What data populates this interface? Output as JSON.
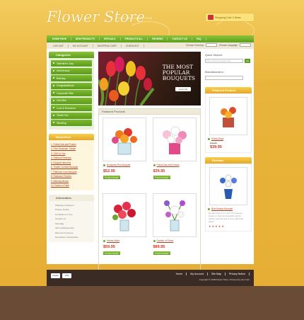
{
  "header": {
    "logo": "Flower Store",
    "tagline": "YOUR FAVORITE STORE",
    "cart_label": "Shopping Cart: 0 items"
  },
  "nav": [
    "HOME PAGE",
    "NEW PRODUCTS",
    "SPECIALS",
    "PRODUCTS ALL",
    "REVIEWS",
    "CONTACT US",
    "FAQ"
  ],
  "subnav": [
    "LOG OUT",
    "MY ACCOUNT",
    "SHOPPING CART",
    "CHECKOUT"
  ],
  "currency": {
    "label": "Choose Currency",
    "language": "Choose Language"
  },
  "categories": {
    "title": "Categories",
    "items": [
      "Valentine's Day",
      "Anniversary",
      "Birthday",
      "Congratulations",
      "Corporate Gifts",
      "Get Well",
      "Love & Romance",
      "Thank You",
      "Wedding"
    ]
  },
  "bestsellers": {
    "title": "Bestsellers",
    "items": [
      "1. Polka Dots and Posies",
      "2. Pink Reminder Tribute",
      "3. Gift For You",
      "4. Refined Presence",
      "5. Elegant Harmony",
      "6. Tender Comfort Bouquet",
      "7. Rainbow Love Bouquet",
      "8. Radiance Flowers",
      "9. Birthday Bloom",
      "10. Roses of Faith"
    ]
  },
  "information": {
    "title": "Information",
    "items": [
      "Shipping & Returns",
      "Privacy Notice",
      "Conditions of Use",
      "Contact Us",
      "Site Map",
      "Gift Certificate FAQ",
      "Discount Coupons",
      "Newsletter Unsubscribe"
    ]
  },
  "banner": {
    "line1": "THE MOST",
    "line2": "POPULAR",
    "line3": "BOUQUETS",
    "button": "more info"
  },
  "featured": {
    "title": "Featured Products",
    "products": [
      {
        "name": "Bouquets Plus Bouquet",
        "price": "$52.95",
        "button": "Product Details"
      },
      {
        "name": "Polka Dots and Posies",
        "price": "$39.95",
        "button": "Product Details"
      },
      {
        "name": "Hearts Allure",
        "price": "$59.95",
        "button": "Product Details"
      },
      {
        "name": "Garden of Grace",
        "price": "$89.95",
        "button": "Product Details"
      }
    ]
  },
  "quick_search": {
    "title": "Quick Search:",
    "placeholder": "Enter search keywords here",
    "go": "GO"
  },
  "manufacturers": {
    "title": "Manufacturers:"
  },
  "featured_right": {
    "title": "Featured Product",
    "name": "Sunny Days",
    "old_price": "$45.95",
    "price": "$39.95"
  },
  "reviews": {
    "title": "Reviews",
    "name": "Blue Mosaic Bouquet",
    "note": "My wife loved it so much. The bouquet looked so fresh and beautiful and the delivery was fast and on time. Will order again!"
  },
  "footer": {
    "links": [
      "Home",
      "My Account",
      "Site Map",
      "Privacy Notice"
    ],
    "copyright": "Copyright © 2008 Flower Store. Powered by Zen Cart",
    "pay": [
      "PayPal",
      "VISA"
    ]
  }
}
